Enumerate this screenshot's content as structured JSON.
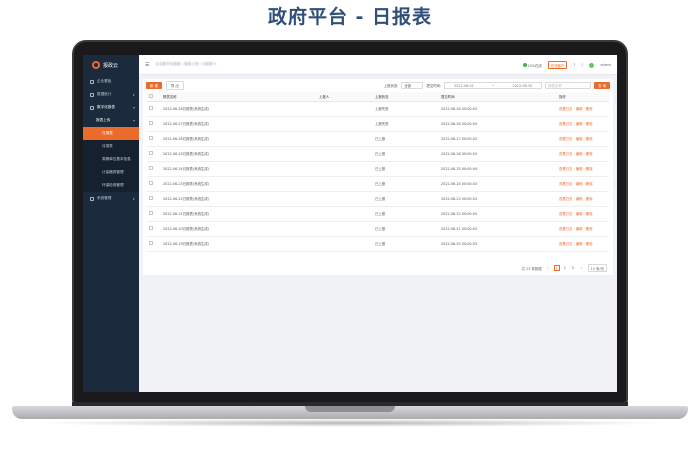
{
  "page_title": "政府平台 - 日报表",
  "sidebar": {
    "logo_text": "报政云",
    "items": [
      {
        "label": "企业看板",
        "level": 0
      },
      {
        "label": "数据统计",
        "level": 0,
        "chev": "▸"
      },
      {
        "label": "数字化报表",
        "level": 0,
        "chev": "▾",
        "bold": true
      },
      {
        "label": "报表上传",
        "level": 1,
        "chev": "▾",
        "bold": true
      },
      {
        "label": "日报表",
        "level": 2,
        "active": true
      },
      {
        "label": "月报表",
        "level": 2
      },
      {
        "label": "周期单位基本信息",
        "level": 2
      },
      {
        "label": "计量器具管理",
        "level": 2
      },
      {
        "label": "环保检测管理",
        "level": 2
      },
      {
        "label": "系统管理",
        "level": 0,
        "chev": "▸"
      }
    ]
  },
  "topbar": {
    "menu_icon": "☰",
    "breadcrumb": "企业数字化报表 / 报表上传 / 日报表 ▾",
    "online_label": "10%在线",
    "tag_label": "在线客户",
    "user_name": "admin"
  },
  "toolbar": {
    "add_label": "新 增",
    "export_label": "导 出",
    "status_label": "上报状态:",
    "status_value": "全部",
    "date_label": "提交时间:",
    "date_start": "2022-06-01",
    "date_sep": "~",
    "date_end": "2022-06-30",
    "search_placeholder": "报表名称",
    "search_label": "查 询"
  },
  "table": {
    "headers": [
      "报表名称",
      "上报人",
      "上报状态",
      "提交时间",
      "操作"
    ],
    "rows": [
      {
        "name": "2022-06-28日报表(系统生成)",
        "reporter": "",
        "status": "上报失败",
        "time": "2022-06-28 00:00:03",
        "actions": "查看日志 · 编辑 · 删除"
      },
      {
        "name": "2022-06-27日报表(系统生成)",
        "reporter": "",
        "status": "上报失败",
        "time": "2022-06-28 00:00:04",
        "actions": "查看日志 · 编辑 · 删除"
      },
      {
        "name": "2022-06-26日报表(系统生成)",
        "reporter": "",
        "status": "已上报",
        "time": "2022-06-27 00:00:03",
        "actions": "查看日志 · 编辑 · 删除"
      },
      {
        "name": "2022-06-25日报表(系统生成)",
        "reporter": "",
        "status": "已上报",
        "time": "2022-06-26 00:00:03",
        "actions": "查看日志 · 编辑 · 删除"
      },
      {
        "name": "2022-06-24日报表(系统生成)",
        "reporter": "",
        "status": "已上报",
        "time": "2022-06-25 00:00:04",
        "actions": "查看日志 · 编辑 · 删除"
      },
      {
        "name": "2022-06-23日报表(系统生成)",
        "reporter": "",
        "status": "已上报",
        "time": "2022-06-24 00:00:03",
        "actions": "查看日志 · 编辑 · 删除"
      },
      {
        "name": "2022-06-22日报表(系统生成)",
        "reporter": "",
        "status": "已上报",
        "time": "2022-06-23 00:00:03",
        "actions": "查看日志 · 编辑 · 删除"
      },
      {
        "name": "2022-06-21日报表(系统生成)",
        "reporter": "",
        "status": "已上报",
        "time": "2022-06-22 00:00:03",
        "actions": "查看日志 · 编辑 · 删除"
      },
      {
        "name": "2022-06-20日报表(系统生成)",
        "reporter": "",
        "status": "已上报",
        "time": "2022-06-21 00:00:03",
        "actions": "查看日志 · 编辑 · 删除"
      },
      {
        "name": "2022-06-19日报表(系统生成)",
        "reporter": "",
        "status": "已上报",
        "time": "2022-06-20 00:00:03",
        "actions": "查看日志 · 编辑 · 删除"
      }
    ]
  },
  "pager": {
    "total": "共 23 条数据",
    "prev": "‹",
    "pages": [
      "1",
      "2",
      "3"
    ],
    "current": "1",
    "next": "›",
    "page_size": "10 条/页"
  },
  "colors": {
    "accent": "#ea6b2a",
    "sidebar_bg": "#1b2a3c",
    "title": "#2f4f7a"
  }
}
